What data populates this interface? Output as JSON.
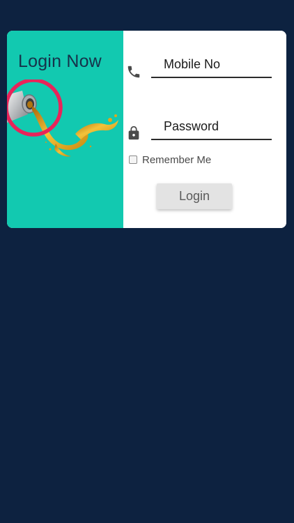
{
  "header": {
    "title": "Login Now"
  },
  "form": {
    "mobile": {
      "placeholder": "Mobile No",
      "icon": "phone-icon"
    },
    "password": {
      "placeholder": "Password",
      "icon": "lock-icon"
    },
    "remember_label": "Remember Me",
    "remember_checked": false,
    "login_label": "Login"
  },
  "colors": {
    "page_background": "#0d2240",
    "left_panel": "#12c9b0",
    "ring_accent": "#e8245a",
    "oil": "#e0a81c",
    "button_background": "#e3e3e3"
  }
}
